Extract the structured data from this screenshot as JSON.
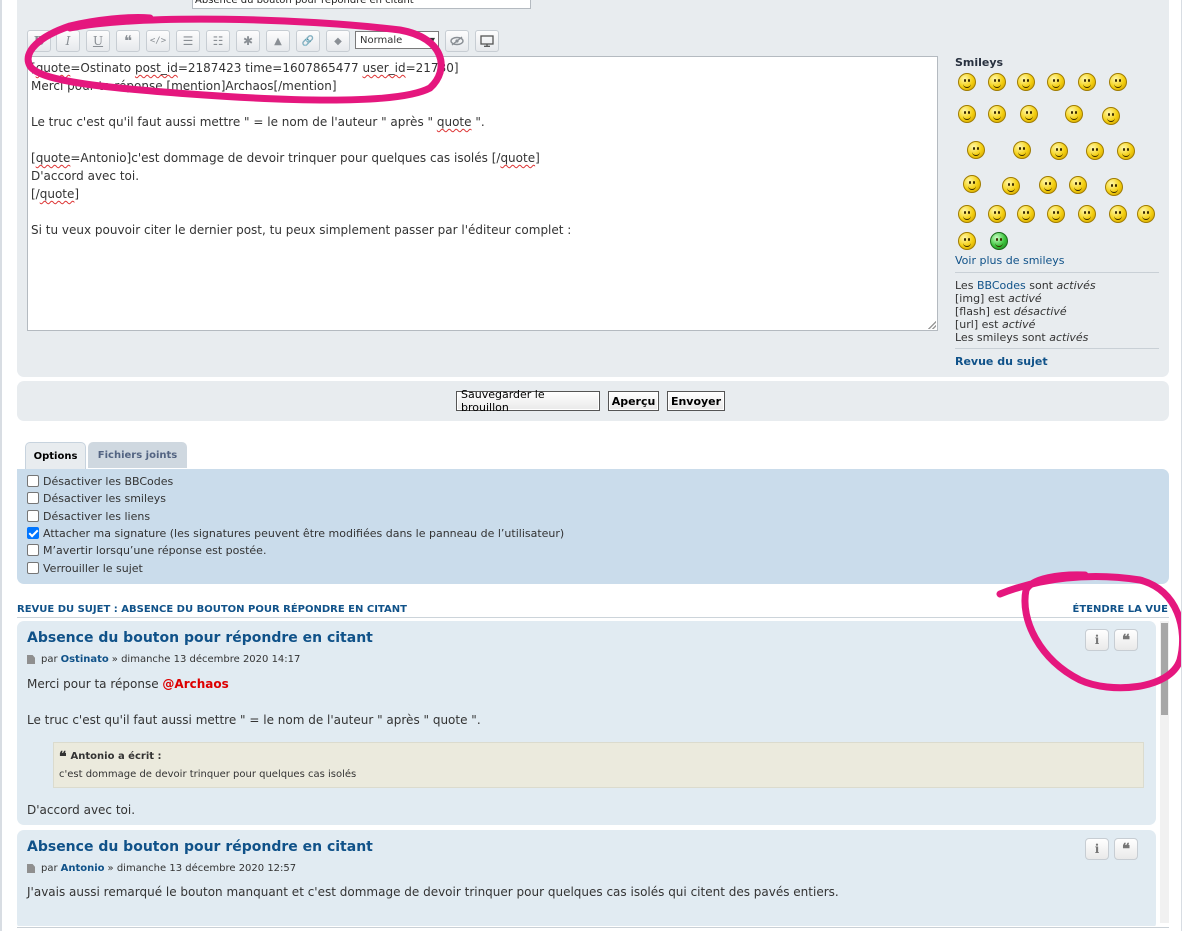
{
  "subject": {
    "value": "Absence du bouton pour répondre en citant"
  },
  "toolbar": {
    "buttons": [
      {
        "label": "B",
        "icon": "bold-icon"
      },
      {
        "label": "I",
        "icon": "italic-icon"
      },
      {
        "label": "U",
        "icon": "underline-icon"
      },
      {
        "label": "❝",
        "icon": "quote-icon"
      },
      {
        "label": "</>",
        "icon": "code-icon"
      },
      {
        "label": "☰",
        "icon": "list-icon"
      },
      {
        "label": "☷",
        "icon": "ordered-list-icon"
      },
      {
        "label": "✱",
        "icon": "list-item-icon"
      },
      {
        "label": "▲",
        "icon": "image-icon"
      },
      {
        "label": "🔗",
        "icon": "link-icon"
      },
      {
        "label": "◆",
        "icon": "color-icon"
      }
    ],
    "font_size": "Normale",
    "hide_icon": "eye-slash-icon",
    "preview_icon": "monitor-icon"
  },
  "editor": {
    "line1_a": "[",
    "line1_b": "quote",
    "line1_c": "=Ostinato ",
    "line1_d": "post_id",
    "line1_e": "=2187423 time=1607865477 ",
    "line1_f": "user_id",
    "line1_g": "=21730]",
    "line2": "Merci pour ta réponse [mention]Archaos[/mention]",
    "line3": "Le truc c'est qu'il faut aussi mettre \" = le nom de l'auteur \" après \" ",
    "line3_spell": "quote",
    "line3_end": " \".",
    "line4_a": "[",
    "line4_b": "quote",
    "line4_c": "=Antonio]c'est dommage de devoir trinquer pour quelques cas isolés [/",
    "line4_d": "quote",
    "line4_e": "]",
    "line5": "D'accord avec toi.",
    "line6_a": "[/",
    "line6_b": "quote",
    "line6_c": "]",
    "line7": "Si tu veux pouvoir citer le dernier post, tu peux simplement passer par l'éditeur complet :"
  },
  "smileys": {
    "title": "Smileys",
    "more_link": "Voir plus de smileys",
    "count": 29
  },
  "bbcode_status": {
    "l1_a": "Les ",
    "l1_link": "BBCodes",
    "l1_b": " sont ",
    "l1_c": "activés",
    "l2_a": "[img] est ",
    "l2_b": "activé",
    "l3_a": "[flash] est ",
    "l3_b": "désactivé",
    "l4_a": "[url] est ",
    "l4_b": "activé",
    "l5_a": "Les smileys sont ",
    "l5_b": "activés"
  },
  "topic_review_link": "Revue du sujet",
  "actions": {
    "save_draft": "Sauvegarder le brouillon",
    "preview": "Aperçu",
    "submit": "Envoyer"
  },
  "tabs": {
    "options": "Options",
    "attachments": "Fichiers joints"
  },
  "options": [
    {
      "label": "Désactiver les BBCodes",
      "checked": false
    },
    {
      "label": "Désactiver les smileys",
      "checked": false
    },
    {
      "label": "Désactiver les liens",
      "checked": false
    },
    {
      "label": "Attacher ma signature (les signatures peuvent être modifiées dans le panneau de l’utilisateur)",
      "checked": true
    },
    {
      "label": "M’avertir lorsqu’une réponse est postée.",
      "checked": false
    },
    {
      "label": "Verrouiller le sujet",
      "checked": false
    }
  ],
  "review": {
    "title": "Revue du sujet : Absence du bouton pour répondre en citant",
    "expand": "Étendre la vue",
    "posts": [
      {
        "title": "Absence du bouton pour répondre en citant",
        "by": "par",
        "author": "Ostinato",
        "date": "» dimanche 13 décembre 2020 14:17",
        "body1_a": "Merci pour ta réponse ",
        "body1_mention": "@Archaos",
        "body2": "Le truc c'est qu'il faut aussi mettre \" = le nom de l'auteur \" après \" quote \".",
        "quote_author": "Antonio a écrit :",
        "quote_text": "c'est dommage de devoir trinquer pour quelques cas isolés",
        "body3": "D'accord avec toi."
      },
      {
        "title": "Absence du bouton pour répondre en citant",
        "by": "par",
        "author": "Antonio",
        "date": "» dimanche 13 décembre 2020 12:57",
        "body1": "J'avais aussi remarqué le bouton manquant et c'est dommage de devoir trinquer pour quelques cas isolés qui citent des pavés entiers."
      }
    ],
    "info_glyph": "i",
    "quote_glyph": "❝"
  },
  "colors": {
    "link": "#105289",
    "panel": "#e8ecef",
    "options_panel": "#cadceb",
    "post_bg": "#e1ebf2",
    "annotation": "#e5177e",
    "mention": "#dd0000"
  }
}
